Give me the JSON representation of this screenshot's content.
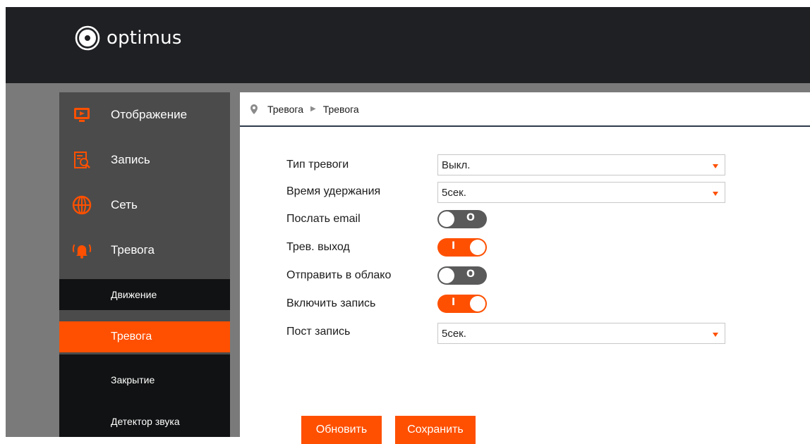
{
  "brand": {
    "name": "optimus"
  },
  "sidebar": {
    "items": [
      {
        "label": "Отображение",
        "icon": "monitor-play-icon"
      },
      {
        "label": "Запись",
        "icon": "record-search-icon"
      },
      {
        "label": "Сеть",
        "icon": "globe-icon"
      },
      {
        "label": "Тревога",
        "icon": "alarm-bell-icon"
      }
    ],
    "subitems": [
      {
        "label": "Движение",
        "active": false
      },
      {
        "label": "Тревога",
        "active": true
      },
      {
        "label": "Закрытие",
        "active": false
      },
      {
        "label": "Детектор звука",
        "active": false
      }
    ]
  },
  "breadcrumb": {
    "section": "Тревога",
    "page": "Тревога"
  },
  "form": {
    "alarm_type": {
      "label": "Тип тревоги",
      "value": "Выкл."
    },
    "hold_time": {
      "label": "Время удержания",
      "value": "5сек."
    },
    "send_email": {
      "label": "Послать email",
      "state": "off",
      "glyph": "O"
    },
    "alarm_out": {
      "label": "Трев. выход",
      "state": "on",
      "glyph": "I"
    },
    "send_cloud": {
      "label": "Отправить в облако",
      "state": "off",
      "glyph": "O"
    },
    "enable_record": {
      "label": "Включить запись",
      "state": "on",
      "glyph": "I"
    },
    "post_record": {
      "label": "Пост запись",
      "value": "5сек."
    }
  },
  "buttons": {
    "refresh": "Обновить",
    "save": "Сохранить"
  },
  "colors": {
    "accent": "#fe5000",
    "header": "#1f2024",
    "sidebar": "#4b4b4b",
    "submenu": "#111213"
  }
}
